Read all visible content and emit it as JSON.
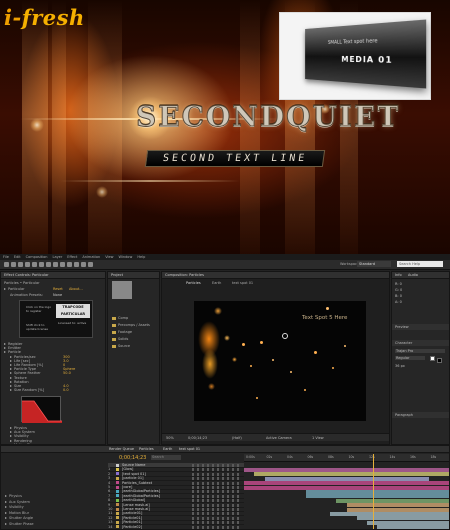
{
  "hero": {
    "logo_i": "i",
    "logo_dash": "-",
    "logo_fresh": "fresh",
    "title": "SECONDQUIET",
    "subtitle": "SECOND TEXT LINE",
    "inset": {
      "small_text": "SMALL Text spot here",
      "big_text": "MEDIA 01"
    }
  },
  "app": {
    "menu": [
      "File",
      "Edit",
      "Composition",
      "Layer",
      "Effect",
      "Animation",
      "View",
      "Window",
      "Help"
    ],
    "workspace_label": "Workspace:",
    "workspace_value": "Standard",
    "help_placeholder": "Search Help",
    "effect_panel": {
      "tab": "Effect Controls: Particular",
      "breadcrumb": "Particles • Particular",
      "effect_name": "Particular",
      "reset": "Reset",
      "about": "About...",
      "preset_label": "Animation Presets:",
      "preset_value": "None",
      "product_name": "TRAPCODE PARTICULAR",
      "note1": "Click on the logo to register",
      "note2": "Shift click to update license",
      "note3": "Licensed to: active",
      "rows": [
        {
          "label": "Register",
          "value": ""
        },
        {
          "label": "Emitter",
          "value": ""
        },
        {
          "label": "Particle",
          "value": ""
        },
        {
          "label": "Particles/sec",
          "value": "300"
        },
        {
          "label": "Life [sec]",
          "value": "3.0"
        },
        {
          "label": "Life Random [%]",
          "value": "0"
        },
        {
          "label": "Particle Type",
          "value": "Sphere"
        },
        {
          "label": "Sphere Feather",
          "value": "50.0"
        },
        {
          "label": "Texture",
          "value": ""
        },
        {
          "label": "Rotation",
          "value": ""
        },
        {
          "label": "Size",
          "value": "4.0"
        },
        {
          "label": "Size Random [%]",
          "value": "0.0"
        },
        {
          "label": "Size over Life",
          "value": ""
        },
        {
          "label": "Opacity",
          "value": "100.0"
        },
        {
          "label": "Opacity Random [%]",
          "value": "0.0"
        },
        {
          "label": "Opacity over Life",
          "value": ""
        },
        {
          "label": "Set Color",
          "value": "At Start"
        },
        {
          "label": "Color",
          "value": ""
        },
        {
          "label": "Color Random",
          "value": "0.0"
        },
        {
          "label": "Transfer Mode",
          "value": "Add"
        },
        {
          "label": "Physics",
          "value": ""
        },
        {
          "label": "Aux System",
          "value": ""
        },
        {
          "label": "Visibility",
          "value": ""
        },
        {
          "label": "Rendering",
          "value": ""
        },
        {
          "label": "Motion Blur",
          "value": ""
        }
      ]
    },
    "project_panel": {
      "tab": "Project",
      "folders": [
        "Comp",
        "Precomps / Assets",
        "Footage",
        "Solids",
        "Source"
      ]
    },
    "comp_panel": {
      "tab": "Composition: Particles",
      "subtabs": [
        "Particles",
        "Earth",
        "text spot 01"
      ],
      "viewer_text": "Text Spot 5 Here",
      "zoom": "50%",
      "timecode": "0;00;14;23",
      "quality": "(Half)",
      "camera": "Active Camera",
      "views": "1 View"
    },
    "right_panel": {
      "tab1": "Info",
      "tab2": "Audio",
      "values": [
        "R: 0",
        "G: 0",
        "B: 0",
        "A: 0"
      ],
      "preview_tab": "Preview",
      "char_tab": "Character",
      "font": "Trajan Pro",
      "style": "Regular",
      "size": "36 px",
      "paragraph_tab": "Paragraph"
    },
    "timeline": {
      "tabs": [
        "Render Queue",
        "Particles",
        "Earth",
        "text spot 01"
      ],
      "time": "0;00;14;23",
      "search_placeholder": "Search",
      "ruler_ticks": [
        "0:00s",
        "02s",
        "04s",
        "06s",
        "08s",
        "10s",
        "12s",
        "14s",
        "16s",
        "18s"
      ],
      "layers": [
        {
          "num": "",
          "name": "Source Name",
          "color": "#cccccc"
        },
        {
          "num": "1",
          "name": "[Glow]",
          "color": "#d8c14a"
        },
        {
          "num": "2",
          "name": "[text spot 01]",
          "color": "#8a6fd0"
        },
        {
          "num": "3",
          "name": "[particle 01]",
          "color": "#c8a84a"
        },
        {
          "num": "4",
          "name": "Particles_Subtext",
          "color": "#c04a8a"
        },
        {
          "num": "5",
          "name": "[core]",
          "color": "#c04a8a"
        },
        {
          "num": "6",
          "name": "[earthGlobalParticles]",
          "color": "#4aa8c0"
        },
        {
          "num": "7",
          "name": "[earthGlobalParticles]",
          "color": "#4aa8c0"
        },
        {
          "num": "8",
          "name": "[earthGlobal]",
          "color": "#7ac04a"
        },
        {
          "num": "9",
          "name": "[Lense mask.ai]",
          "color": "#c08a4a"
        },
        {
          "num": "10",
          "name": "[Lense mask.ai]",
          "color": "#c08a4a"
        },
        {
          "num": "11",
          "name": "[particle01]",
          "color": "#c8a84a"
        },
        {
          "num": "12",
          "name": "[Particle01]",
          "color": "#c8a84a"
        },
        {
          "num": "13",
          "name": "[Particle01]",
          "color": "#c8a84a"
        },
        {
          "num": "14",
          "name": "[Particle02]",
          "color": "#c8a84a"
        }
      ],
      "properties": [
        "Physics",
        "Aux System",
        "Visibility",
        "Motion Blur",
        "Shutter Angle",
        "Shutter Phase"
      ]
    }
  }
}
